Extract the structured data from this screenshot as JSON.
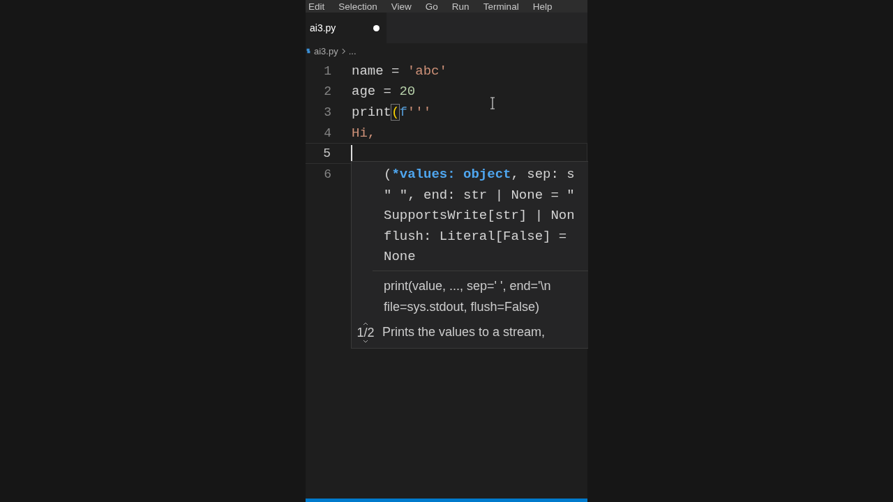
{
  "menu": [
    "Edit",
    "Selection",
    "View",
    "Go",
    "Run",
    "Terminal",
    "Help"
  ],
  "tabs": [
    {
      "label": "ai3.py",
      "selected": true,
      "modified": true
    }
  ],
  "breadcrumb": {
    "file": "ai3.py",
    "rest": "..."
  },
  "lines": [
    {
      "number": "1",
      "current": false,
      "tokens": [
        {
          "kind": "plain",
          "text": "name = "
        },
        {
          "kind": "string",
          "text": "'abc'"
        }
      ]
    },
    {
      "number": "2",
      "current": false,
      "tokens": [
        {
          "kind": "plain",
          "text": "age = "
        },
        {
          "kind": "number",
          "text": "20"
        }
      ]
    },
    {
      "number": "3",
      "current": false,
      "tokens": [
        {
          "kind": "plain",
          "text": "print"
        },
        {
          "kind": "bracket",
          "text": "("
        },
        {
          "kind": "keyword",
          "text": "f"
        },
        {
          "kind": "string",
          "text": "'''"
        }
      ]
    },
    {
      "number": "4",
      "current": false,
      "tokens": [
        {
          "kind": "string",
          "text": "Hi,"
        }
      ]
    },
    {
      "number": "5",
      "current": true
    },
    {
      "number": "6",
      "current": false
    }
  ],
  "hover": {
    "signature": [
      [
        {
          "kind": "plain",
          "text": "("
        },
        {
          "kind": "param",
          "text": "*values: object"
        },
        {
          "kind": "plain",
          "text": ", sep: s"
        }
      ],
      [
        {
          "kind": "plain",
          "text": "\" \", end: str | None = \""
        }
      ],
      [
        {
          "kind": "plain",
          "text": "SupportsWrite[str] | Non"
        }
      ],
      [
        {
          "kind": "plain",
          "text": "flush: Literal[False] ="
        }
      ],
      [
        {
          "kind": "plain",
          "text": "None"
        }
      ]
    ],
    "doc": [
      "print(value, ..., sep=' ', end='\\n",
      "file=sys.stdout, flush=False)"
    ],
    "counter": "1/2",
    "description": "Prints the values to a stream,"
  }
}
